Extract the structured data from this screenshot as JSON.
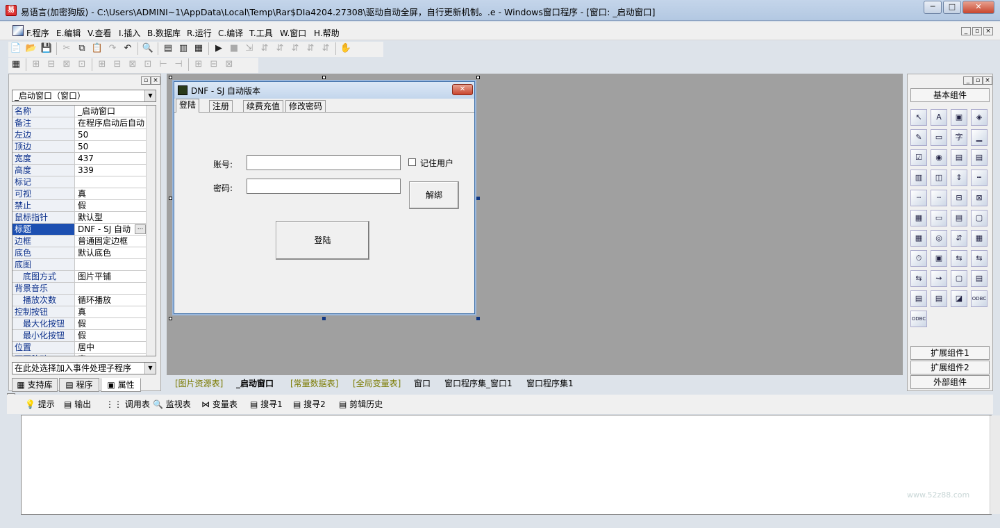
{
  "window": {
    "title": "易语言(加密狗版) - C:\\Users\\ADMINI~1\\AppData\\Local\\Temp\\Rar$DIa4204.27308\\驱动自动全屏，自行更新机制。.e - Windows窗口程序 - [窗口: _启动窗口]",
    "minimize": "─",
    "maximize": "□",
    "close": "✕"
  },
  "menu": {
    "items": [
      "F.程序",
      "E.编辑",
      "V.查看",
      "I.插入",
      "B.数据库",
      "R.运行",
      "C.编译",
      "T.工具",
      "W.窗口",
      "H.帮助"
    ],
    "mdi": [
      "_",
      "▫",
      "×"
    ]
  },
  "toolbar1": [
    "📄",
    "📂",
    "💾",
    "|",
    "✂",
    "⧉",
    "📋",
    "↷",
    "↶",
    "|",
    "🔍",
    "|",
    "▤",
    "▥",
    "▦",
    "|",
    "▶",
    "■",
    "⇲",
    "⇵",
    "⇵",
    "⇵",
    "⇵",
    "⇵",
    "|",
    "✋"
  ],
  "toolbar2": [
    "▦",
    "|",
    "⊞",
    "⊟",
    "⊠",
    "⊡",
    "|",
    "⊞",
    "⊟",
    "⊠",
    "⊡",
    "⊢",
    "⊣",
    "|",
    "⊞",
    "⊟",
    "⊠"
  ],
  "props": {
    "object_select": "_启动窗口（窗口）",
    "event_select": "在此处选择加入事件处理子程序",
    "rows": [
      {
        "name": "名称",
        "value": "_启动窗口"
      },
      {
        "name": "备注",
        "value": "在程序启动后自动"
      },
      {
        "name": "左边",
        "value": "50"
      },
      {
        "name": "顶边",
        "value": "50"
      },
      {
        "name": "宽度",
        "value": "437"
      },
      {
        "name": "高度",
        "value": "339"
      },
      {
        "name": "标记",
        "value": ""
      },
      {
        "name": "可视",
        "value": "真"
      },
      {
        "name": "禁止",
        "value": "假"
      },
      {
        "name": "鼠标指针",
        "value": "默认型"
      },
      {
        "name": "标题",
        "value": "DNF - SJ 自动"
      },
      {
        "name": "边框",
        "value": "普通固定边框"
      },
      {
        "name": "底色",
        "value": "默认底色"
      },
      {
        "name": "底图",
        "value": ""
      },
      {
        "name": "底图方式",
        "value": "图片平铺"
      },
      {
        "name": "背景音乐",
        "value": ""
      },
      {
        "name": "播放次数",
        "value": "循环播放"
      },
      {
        "name": "控制按钮",
        "value": "真"
      },
      {
        "name": "最大化按钮",
        "value": "假"
      },
      {
        "name": "最小化按钮",
        "value": "假"
      },
      {
        "name": "位置",
        "value": "居中"
      },
      {
        "name": "可否移动",
        "value": "真"
      }
    ],
    "ellipsis": "···",
    "tabs": [
      "支持库",
      "程序",
      "属性"
    ]
  },
  "form": {
    "title": "DNF - SJ 自动版本",
    "close": "✕",
    "tabs": [
      "登陆",
      "注册",
      "续费充值",
      "修改密码"
    ],
    "account_label": "账号:",
    "password_label": "密码:",
    "remember_label": "记住用户",
    "unbind_button": "解绑",
    "login_button": "登陆"
  },
  "bottom_tabs": [
    "[图片资源表]",
    "_启动窗口",
    "[常量数据表]",
    "[全局变量表]",
    "窗口",
    "窗口程序集_窗口1",
    "窗口程序集1"
  ],
  "components": {
    "header": "基本组件",
    "icons": [
      "↖",
      "A",
      "▣",
      "◈",
      "✎",
      "▭",
      "字",
      "▁",
      "☑",
      "◉",
      "▤",
      "▤",
      "▥",
      "◫",
      "⇕",
      "┅",
      "┄",
      "┄",
      "⊟",
      "⊠",
      "▦",
      "▭",
      "▤",
      "▢",
      "▦",
      "◎",
      "⇵",
      "▦",
      "⏱",
      "▣",
      "⇆",
      "⇆",
      "⇆",
      "⇝",
      "▢",
      "▤",
      "▤",
      "▤",
      "◪",
      "ODBC",
      "ODBC"
    ],
    "ext1": "扩展组件1",
    "ext2": "扩展组件2",
    "external": "外部组件"
  },
  "output_tabs": [
    "提示",
    "输出",
    "调用表",
    "监视表",
    "变量表",
    "搜寻1",
    "搜寻2",
    "剪辑历史"
  ],
  "watermark": "www.52z88.com"
}
